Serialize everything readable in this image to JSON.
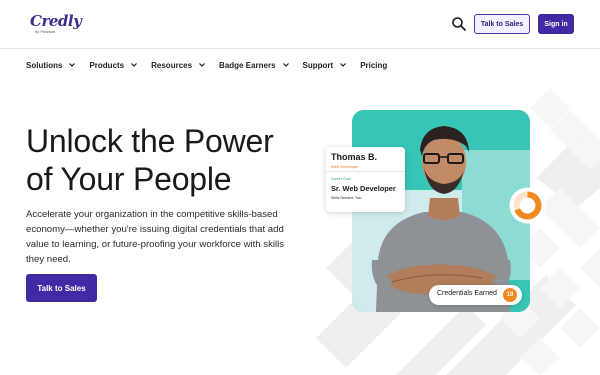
{
  "header": {
    "logo_text": "Credly",
    "logo_subtext": "by Pearson",
    "search_icon": "search-icon",
    "talk_to_sales_label": "Talk to Sales",
    "sign_in_label": "Sign in"
  },
  "nav": {
    "items": [
      {
        "label": "Solutions",
        "has_dropdown": true
      },
      {
        "label": "Products",
        "has_dropdown": true
      },
      {
        "label": "Resources",
        "has_dropdown": true
      },
      {
        "label": "Badge Earners",
        "has_dropdown": true
      },
      {
        "label": "Support",
        "has_dropdown": true
      },
      {
        "label": "Pricing",
        "has_dropdown": false
      }
    ]
  },
  "hero": {
    "title_line1": "Unlock the Power",
    "title_line2": "of Your People",
    "description": "Accelerate your organization in the competitive skills-based economy—whether you're issuing digital credentials that add value to learning, or future-proofing your workforce with skills they need.",
    "cta_label": "Talk to Sales"
  },
  "profile_card": {
    "name": "Thomas B.",
    "role": "Web Developer",
    "goal_label": "Career Goal",
    "goal": "Sr. Web Developer",
    "skills_needed": "Skills Needed: Two"
  },
  "credentials": {
    "label": "Credentials Earned",
    "count": "19"
  },
  "colors": {
    "brand_purple": "#4328a6",
    "teal": "#38c5b5",
    "orange": "#f08a1f"
  }
}
